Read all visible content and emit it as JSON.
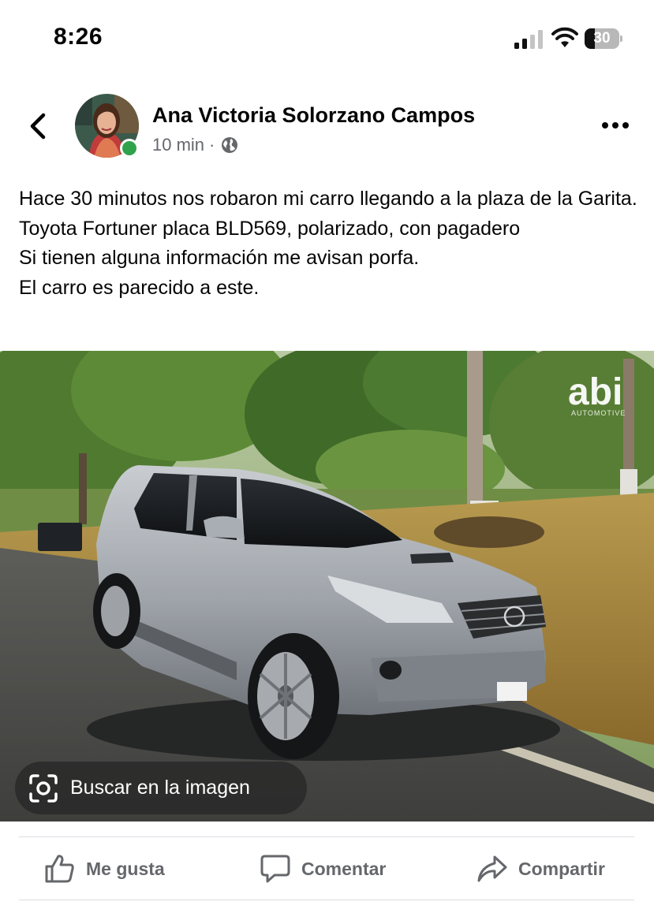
{
  "status_bar": {
    "time": "8:26",
    "battery_level": "30",
    "icons": [
      "cellular-signal-icon",
      "wifi-icon",
      "battery-icon"
    ]
  },
  "post": {
    "author": "Ana Victoria Solorzano Campos",
    "timestamp": "10 min",
    "separator": "·",
    "privacy_icon": "globe-icon",
    "text_lines": [
      "Hace 30 minutos nos robaron mi carro llegando a la plaza de la Garita. Toyota Fortuner placa BLD569, polarizado, con pagadero",
      "Si tienen alguna información me avisan porfa.",
      "El carro es parecido a este."
    ],
    "photo": {
      "watermark": "abi",
      "watermark_sub": "AUTOMOTIVE",
      "lens_label": "Buscar en la imagen"
    }
  },
  "actions": {
    "like": "Me gusta",
    "comment": "Comentar",
    "share": "Compartir"
  },
  "colors": {
    "text": "#050505",
    "secondary_text": "#65676b",
    "online": "#31a24c",
    "divider": "#dadde1"
  }
}
